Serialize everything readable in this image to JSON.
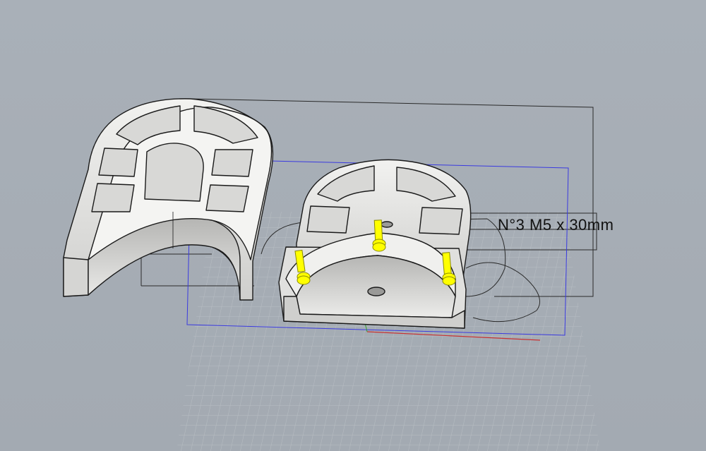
{
  "viewport": {
    "annotation_text": "N°3 M5 x 30mm"
  },
  "colors": {
    "background": "#a6adb5",
    "grid": "#bfc4c9",
    "part": "#e8e8e6",
    "outline": "#1a1a1a",
    "selection": "#3b3bd6",
    "bolt": "#ffff00",
    "axis_x": "#c83232",
    "axis_y": "#32a032"
  }
}
